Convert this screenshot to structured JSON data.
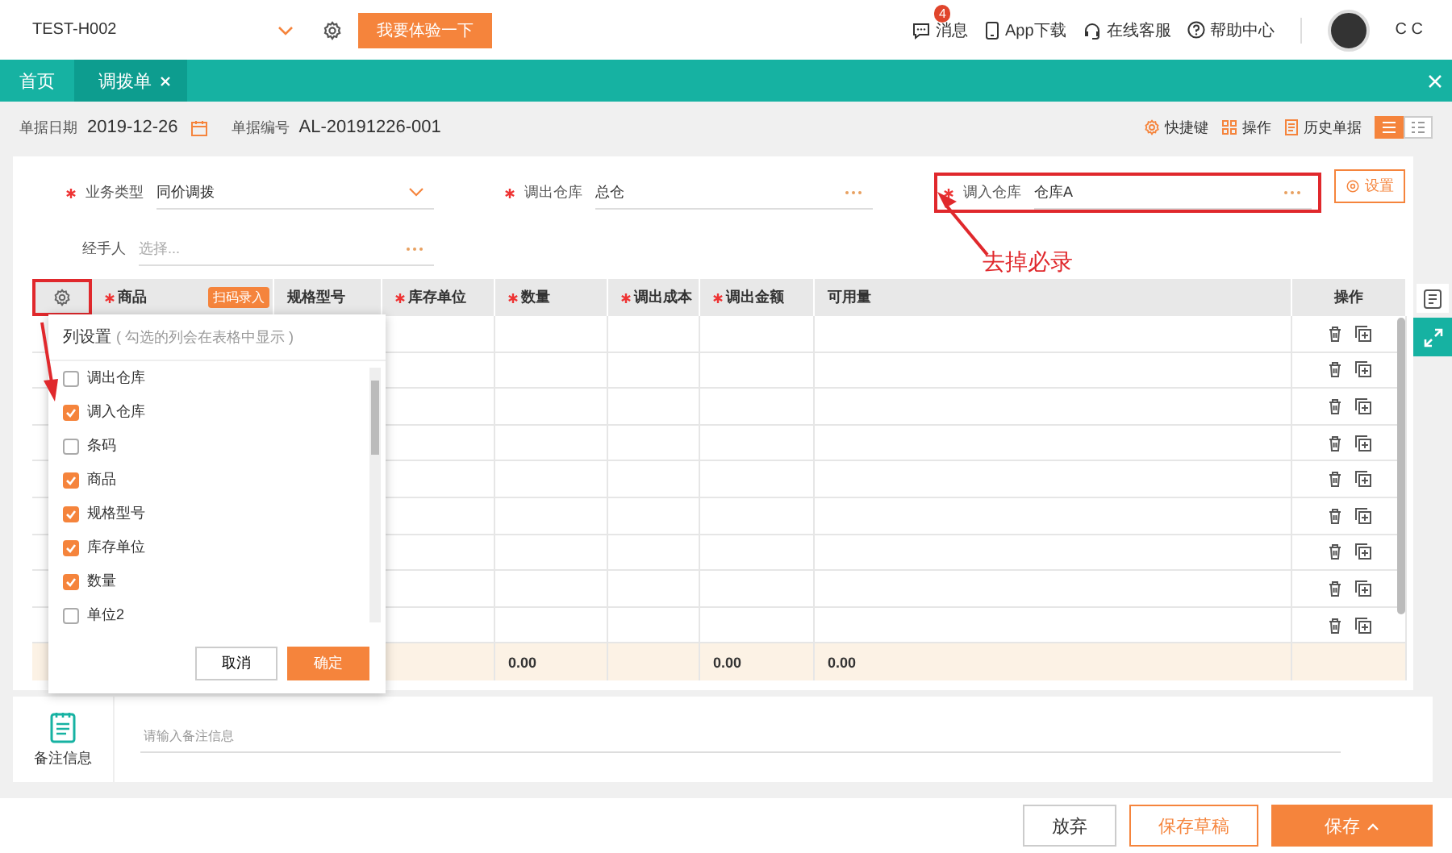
{
  "header": {
    "account": "TEST-H002",
    "trial_button": "我要体验一下",
    "links": [
      {
        "kind": "message",
        "label": "消息",
        "badge": "4"
      },
      {
        "kind": "phone",
        "label": "App下载"
      },
      {
        "kind": "headset",
        "label": "在线客服"
      },
      {
        "kind": "help",
        "label": "帮助中心"
      }
    ],
    "user": "C C"
  },
  "tabs": [
    {
      "label": "首页",
      "selected": false,
      "closable": false
    },
    {
      "label": "调拨单",
      "selected": true,
      "closable": true
    }
  ],
  "toolbar": {
    "fields": [
      {
        "label": "单据日期",
        "value": "2019-12-26",
        "kind": "date"
      },
      {
        "label": "单据编号",
        "value": "AL-20191226-001",
        "kind": "text"
      }
    ],
    "actions": [
      {
        "kind": "keyboard",
        "label": "快捷键"
      },
      {
        "kind": "ops",
        "label": "操作"
      },
      {
        "kind": "history",
        "label": "历史单据"
      }
    ],
    "view_modes": [
      {
        "kind": "list",
        "selected": true
      },
      {
        "kind": "card",
        "selected": false
      }
    ]
  },
  "form": {
    "fields": [
      {
        "label": "业务类型",
        "value": "同价调拨",
        "required": true,
        "kind": "dropdown",
        "highlighted": false
      },
      {
        "label": "调出仓库",
        "value": "总仓",
        "required": true,
        "kind": "lookup",
        "highlighted": false
      },
      {
        "label": "调入仓库",
        "value": "仓库A",
        "required": true,
        "kind": "lookup",
        "highlighted": true
      },
      {
        "label": "经手人",
        "placeholder": "选择...",
        "required": false,
        "kind": "lookup",
        "highlighted": false
      }
    ],
    "settings_button": "设置"
  },
  "annotation": {
    "text": "去掉必录"
  },
  "table": {
    "settings_highlighted": true,
    "columns": [
      {
        "label": "商品",
        "required": true,
        "badge": "扫码录入"
      },
      {
        "label": "规格型号",
        "required": false
      },
      {
        "label": "库存单位",
        "required": true
      },
      {
        "label": "数量",
        "required": true,
        "total": "0.00"
      },
      {
        "label": "调出成本",
        "required": true
      },
      {
        "label": "调出金额",
        "required": true,
        "total": "0.00"
      },
      {
        "label": "可用量",
        "required": false,
        "total": "0.00"
      },
      {
        "label": "操作",
        "required": false,
        "kind": "actions"
      }
    ],
    "rows": [
      {
        "kind": "empty"
      },
      {
        "kind": "empty"
      },
      {
        "kind": "empty"
      },
      {
        "kind": "empty"
      },
      {
        "kind": "empty"
      },
      {
        "kind": "empty"
      },
      {
        "kind": "empty"
      },
      {
        "kind": "empty"
      },
      {
        "kind": "empty"
      }
    ]
  },
  "column_settings": {
    "title": "列设置",
    "hint": "( 勾选的列会在表格中显示 )",
    "items": [
      {
        "label": "调出仓库",
        "checked": false
      },
      {
        "label": "调入仓库",
        "checked": true
      },
      {
        "label": "条码",
        "checked": false
      },
      {
        "label": "商品",
        "checked": true
      },
      {
        "label": "规格型号",
        "checked": true
      },
      {
        "label": "库存单位",
        "checked": true
      },
      {
        "label": "数量",
        "checked": true
      },
      {
        "label": "单位2",
        "checked": false
      }
    ],
    "buttons": [
      {
        "label": "取消",
        "kind": "secondary"
      },
      {
        "label": "确定",
        "kind": "primary"
      }
    ]
  },
  "notes": {
    "label": "备注信息",
    "placeholder": "请输入备注信息"
  },
  "footer": {
    "buttons": [
      {
        "label": "放弃",
        "kind": "plain",
        "menu": false
      },
      {
        "label": "保存草稿",
        "kind": "outline",
        "menu": false
      },
      {
        "label": "保存",
        "kind": "primary",
        "menu": true
      }
    ]
  }
}
